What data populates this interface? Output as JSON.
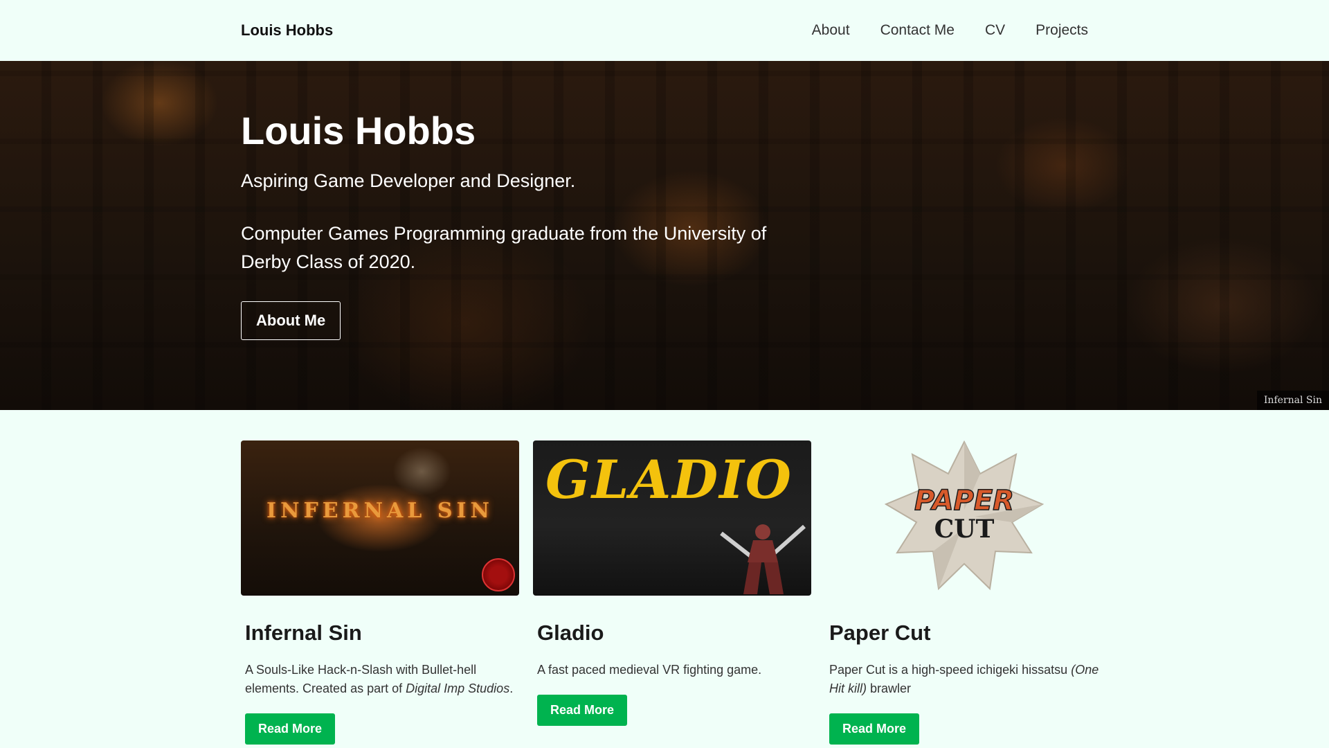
{
  "navbar": {
    "brand": "Louis Hobbs",
    "links": [
      {
        "label": "About"
      },
      {
        "label": "Contact Me"
      },
      {
        "label": "CV"
      },
      {
        "label": "Projects"
      }
    ]
  },
  "hero": {
    "title": "Louis Hobbs",
    "subtitle": "Aspiring Game Developer and Designer.",
    "description": "Computer Games Programming graduate from the University of Derby Class of 2020.",
    "button_label": "About Me",
    "image_caption": "Infernal Sin"
  },
  "projects": [
    {
      "title": "Infernal Sin",
      "art_text": "INFERNAL SIN",
      "text_before": "A Souls-Like Hack-n-Slash with Bullet-hell elements. Created as part of ",
      "text_italic": "Digital Imp Studios",
      "text_after": ".",
      "button_label": "Read More"
    },
    {
      "title": "Gladio",
      "art_text": "GLADIO",
      "text_before": "A fast paced medieval VR fighting game.",
      "text_italic": "",
      "text_after": "",
      "button_label": "Read More"
    },
    {
      "title": "Paper Cut",
      "art_text_line1": "PAPER",
      "art_text_line2": "CUT",
      "text_before": "Paper Cut is a high-speed ichigeki hissatsu ",
      "text_italic": "(One Hit kill)",
      "text_after": " brawler",
      "button_label": "Read More"
    }
  ],
  "colors": {
    "background": "#f0fff9",
    "accent_green": "#00b34f",
    "gladio_yellow": "#f4c20d"
  }
}
